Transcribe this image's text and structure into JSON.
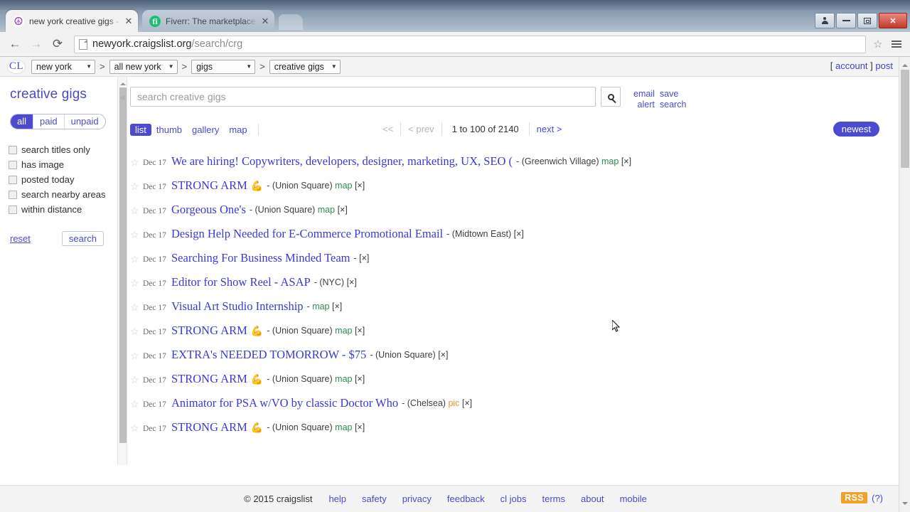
{
  "browser": {
    "tabs": [
      {
        "title": "new york creative gigs - cr",
        "favicon": "craigslist-peace-icon",
        "active": true,
        "close": "✕"
      },
      {
        "title": "Fiverr: The marketplace fo",
        "favicon": "fiverr-icon",
        "active": false,
        "close": "✕"
      }
    ],
    "url_main": "newyork.craigslist.org",
    "url_path": "/search/crg",
    "back_icon": "←",
    "forward_icon": "→",
    "reload_icon": "⟳",
    "star_icon": "☆",
    "window_controls": {
      "profile": "person-icon",
      "minimize": "minimize-icon",
      "restore": "restore-icon",
      "close": "✕"
    }
  },
  "cl_header": {
    "logo": "CL",
    "separator": ">",
    "breadcrumbs": [
      {
        "value": "new york"
      },
      {
        "value": "all new york"
      },
      {
        "value": "gigs"
      },
      {
        "value": "creative gigs"
      }
    ],
    "account_prefix": "[",
    "account": "account",
    "account_suffix": "]",
    "post": "post"
  },
  "sidebar": {
    "title": "creative gigs",
    "segments": [
      {
        "label": "all",
        "active": true
      },
      {
        "label": "paid",
        "active": false
      },
      {
        "label": "unpaid",
        "active": false
      }
    ],
    "checkboxes": [
      {
        "label": "search titles only",
        "checked": false
      },
      {
        "label": "has image",
        "checked": false
      },
      {
        "label": "posted today",
        "checked": false
      },
      {
        "label": "search nearby areas",
        "checked": false
      },
      {
        "label": "within distance",
        "checked": false
      }
    ],
    "reset": "reset",
    "search": "search"
  },
  "search": {
    "placeholder": "search creative gigs",
    "value": "",
    "magnify_icon": "search-icon",
    "email": "email",
    "alert": "alert",
    "save": "save",
    "search_word": "search",
    "collapse_icon": "«"
  },
  "controls": {
    "views": [
      {
        "label": "list",
        "active": true
      },
      {
        "label": "thumb",
        "active": false
      },
      {
        "label": "gallery",
        "active": false
      },
      {
        "label": "map",
        "active": false
      }
    ],
    "pagination": {
      "first": "<<",
      "prev": "< prev",
      "count": "1 to 100 of 2140",
      "next": "next >"
    },
    "sort": "newest"
  },
  "listings": [
    {
      "date": "Dec 17",
      "title": "We are hiring! Copywriters, developers, designer, marketing, UX, SEO (",
      "sep": "-",
      "hood": "(Greenwich Village)",
      "tags": [
        "map"
      ],
      "close": "[×]",
      "arm": false
    },
    {
      "date": "Dec 17",
      "title": "STRONG ARM",
      "sep": "-",
      "hood": "(Union Square)",
      "tags": [
        "map"
      ],
      "close": "[×]",
      "arm": true
    },
    {
      "date": "Dec 17",
      "title": "Gorgeous One's",
      "sep": "-",
      "hood": "(Union Square)",
      "tags": [
        "map"
      ],
      "close": "[×]",
      "arm": false
    },
    {
      "date": "Dec 17",
      "title": "Design Help Needed for E-Commerce Promotional Email",
      "sep": "-",
      "hood": "(Midtown East)",
      "tags": [],
      "close": "[×]",
      "arm": false
    },
    {
      "date": "Dec 17",
      "title": "Searching For Business Minded Team",
      "sep": "-",
      "hood": "",
      "tags": [],
      "close": "[×]",
      "arm": false
    },
    {
      "date": "Dec 17",
      "title": "Editor for Show Reel - ASAP",
      "sep": "-",
      "hood": "(NYC)",
      "tags": [],
      "close": "[×]",
      "arm": false
    },
    {
      "date": "Dec 17",
      "title": "Visual Art Studio Internship",
      "sep": "-",
      "hood": "",
      "tags": [
        "map"
      ],
      "close": "[×]",
      "arm": false
    },
    {
      "date": "Dec 17",
      "title": "STRONG ARM",
      "sep": "-",
      "hood": "(Union Square)",
      "tags": [
        "map"
      ],
      "close": "[×]",
      "arm": true
    },
    {
      "date": "Dec 17",
      "title": "EXTRA's NEEDED TOMORROW - $75",
      "sep": "-",
      "hood": "(Union Square)",
      "tags": [],
      "close": "[×]",
      "arm": false
    },
    {
      "date": "Dec 17",
      "title": "STRONG ARM",
      "sep": "-",
      "hood": "(Union Square)",
      "tags": [
        "map"
      ],
      "close": "[×]",
      "arm": true
    },
    {
      "date": "Dec 17",
      "title": "Animator for PSA w/VO by classic Doctor Who",
      "sep": "-",
      "hood": "(Chelsea)",
      "tags": [
        "pic"
      ],
      "close": "[×]",
      "arm": false
    },
    {
      "date": "Dec 17",
      "title": "STRONG ARM",
      "sep": "-",
      "hood": "(Union Square)",
      "tags": [
        "map"
      ],
      "close": "[×]",
      "arm": true
    }
  ],
  "footer": {
    "copyright": "© 2015 craigslist",
    "links": [
      "help",
      "safety",
      "privacy",
      "feedback",
      "cl jobs",
      "terms",
      "about",
      "mobile"
    ],
    "rss": "RSS",
    "help_mark": "(?)"
  },
  "colors": {
    "cl_blue": "#4b4bd1",
    "link_blue": "#3a3ad4",
    "map_green": "#2e8b57",
    "pic_orange": "#e8972c",
    "rss_orange": "#f2a128"
  }
}
